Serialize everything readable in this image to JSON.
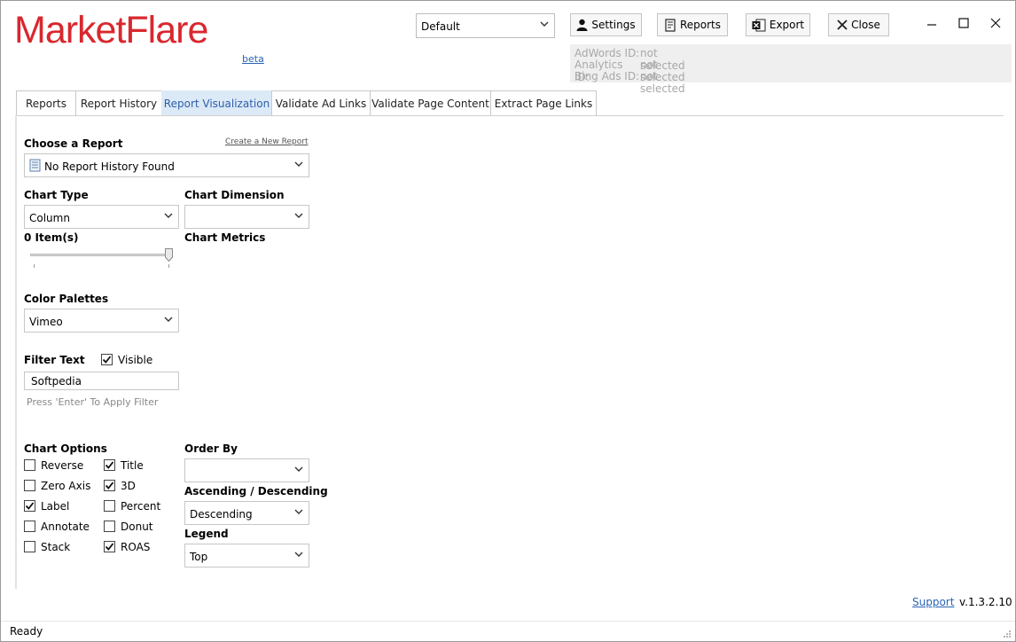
{
  "app": {
    "logo_text": "MarketFlare",
    "beta_label": "beta",
    "brand_color": "#d9272e"
  },
  "header": {
    "profile_value": "Default",
    "buttons": {
      "settings": "Settings",
      "reports": "Reports",
      "export": "Export",
      "close": "Close"
    },
    "ids": [
      {
        "label": "AdWords ID:",
        "value": "not selected"
      },
      {
        "label": "Analytics ID:",
        "value": "not selected"
      },
      {
        "label": "Bing Ads ID:",
        "value": "not selected"
      }
    ]
  },
  "tabs": [
    "Reports",
    "Report History",
    "Report Visualization",
    "Validate Ad Links",
    "Validate Page Content",
    "Extract Page Links"
  ],
  "active_tab": "Report Visualization",
  "form": {
    "choose_report_label": "Choose a Report",
    "create_new_report_link": "Create a New Report",
    "report_value": "No Report History Found",
    "chart_type_label": "Chart Type",
    "chart_type_value": "Column",
    "chart_dimension_label": "Chart Dimension",
    "chart_dimension_value": "",
    "items_label": "0 Item(s)",
    "chart_metrics_label": "Chart Metrics",
    "color_palettes_label": "Color Palettes",
    "color_palette_value": "Vimeo",
    "filter_text_label": "Filter Text",
    "visible_label": "Visible",
    "filter_value": "Softpedia",
    "filter_hint": "Press 'Enter' To Apply Filter",
    "chart_options_label": "Chart Options",
    "options_col1": [
      {
        "label": "Reverse",
        "checked": false
      },
      {
        "label": "Zero Axis",
        "checked": false
      },
      {
        "label": "Label",
        "checked": true
      },
      {
        "label": "Annotate",
        "checked": false
      },
      {
        "label": "Stack",
        "checked": false
      }
    ],
    "options_col2": [
      {
        "label": "Title",
        "checked": true
      },
      {
        "label": "3D",
        "checked": true
      },
      {
        "label": "Percent",
        "checked": false
      },
      {
        "label": "Donut",
        "checked": false
      },
      {
        "label": "ROAS",
        "checked": true
      }
    ],
    "order_by_label": "Order By",
    "order_by_value": "",
    "asc_desc_label": "Ascending / Descending",
    "asc_desc_value": "Descending",
    "legend_label": "Legend",
    "legend_value": "Top"
  },
  "footer": {
    "status": "Ready",
    "support_link": "Support",
    "version": "v.1.3.2.10"
  }
}
